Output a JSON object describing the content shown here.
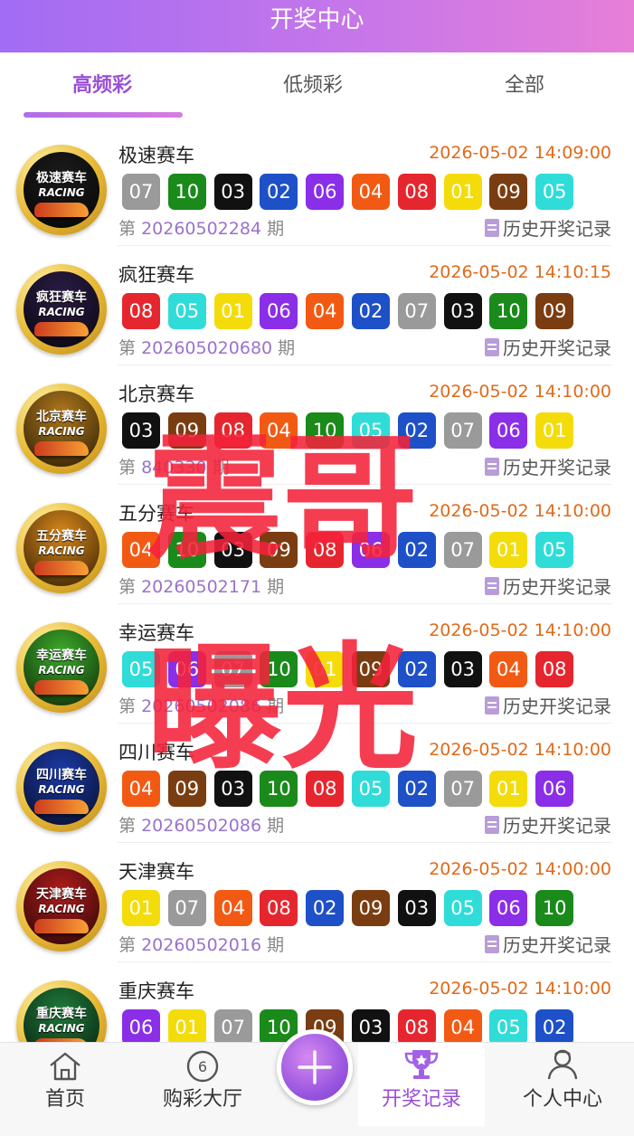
{
  "header": {
    "title": "开奖中心"
  },
  "tabs": [
    {
      "label": "高频彩",
      "active": true
    },
    {
      "label": "低频彩",
      "active": false
    },
    {
      "label": "全部",
      "active": false
    }
  ],
  "ball_colors": {
    "01": "#f4dc0a",
    "02": "#1e50c8",
    "03": "#111111",
    "04": "#f25a14",
    "05": "#2fdcd8",
    "06": "#8a2ee8",
    "07": "#9a9a9a",
    "08": "#e6262e",
    "09": "#7a3d12",
    "10": "#1a8a1a"
  },
  "lotteries": [
    {
      "badge_title": "极速赛车",
      "badge_sub": "RACING",
      "badge_color": "#1b1b1b",
      "name": "极速赛车",
      "time": "2026-05-02 14:09:00",
      "balls": [
        "07",
        "10",
        "03",
        "02",
        "06",
        "04",
        "08",
        "01",
        "09",
        "05"
      ],
      "issue_prefix": "第",
      "issue": "20260502284",
      "issue_suffix": "期",
      "history": "历史开奖记录"
    },
    {
      "badge_title": "疯狂赛车",
      "badge_sub": "RACING",
      "badge_color": "#2a1c44",
      "name": "疯狂赛车",
      "time": "2026-05-02 14:10:15",
      "balls": [
        "08",
        "05",
        "01",
        "06",
        "04",
        "02",
        "07",
        "03",
        "10",
        "09"
      ],
      "issue_prefix": "第",
      "issue": "202605020680",
      "issue_suffix": "期",
      "history": "历史开奖记录"
    },
    {
      "badge_title": "北京赛车",
      "badge_sub": "RACING",
      "badge_color": "#b0781c",
      "name": "北京赛车",
      "time": "2026-05-02 14:10:00",
      "balls": [
        "03",
        "09",
        "08",
        "04",
        "10",
        "05",
        "02",
        "07",
        "06",
        "01"
      ],
      "issue_prefix": "第",
      "issue": "840330",
      "issue_suffix": "期",
      "history": "历史开奖记录"
    },
    {
      "badge_title": "五分赛车",
      "badge_sub": "RACING",
      "badge_color": "#d8871a",
      "name": "五分赛车",
      "time": "2026-05-02 14:10:00",
      "balls": [
        "04",
        "10",
        "03",
        "09",
        "08",
        "06",
        "02",
        "07",
        "01",
        "05"
      ],
      "issue_prefix": "第",
      "issue": "20260502171",
      "issue_suffix": "期",
      "history": "历史开奖记录"
    },
    {
      "badge_title": "幸运赛车",
      "badge_sub": "RACING",
      "badge_color": "#3cac2a",
      "name": "幸运赛车",
      "time": "2026-05-02 14:10:00",
      "balls": [
        "05",
        "06",
        "07",
        "10",
        "01",
        "09",
        "02",
        "03",
        "04",
        "08"
      ],
      "issue_prefix": "第",
      "issue": "20260502086",
      "issue_suffix": "期",
      "history": "历史开奖记录"
    },
    {
      "badge_title": "四川赛车",
      "badge_sub": "RACING",
      "badge_color": "#1c3aa8",
      "name": "四川赛车",
      "time": "2026-05-02 14:10:00",
      "balls": [
        "04",
        "09",
        "03",
        "10",
        "08",
        "05",
        "02",
        "07",
        "01",
        "06"
      ],
      "issue_prefix": "第",
      "issue": "20260502086",
      "issue_suffix": "期",
      "history": "历史开奖记录"
    },
    {
      "badge_title": "天津赛车",
      "badge_sub": "RACING",
      "badge_color": "#b01c1c",
      "name": "天津赛车",
      "time": "2026-05-02 14:00:00",
      "balls": [
        "01",
        "07",
        "04",
        "08",
        "02",
        "09",
        "03",
        "05",
        "06",
        "10"
      ],
      "issue_prefix": "第",
      "issue": "20260502016",
      "issue_suffix": "期",
      "history": "历史开奖记录"
    },
    {
      "badge_title": "重庆赛车",
      "badge_sub": "RACING",
      "badge_color": "#1f7a3a",
      "name": "重庆赛车",
      "time": "2026-05-02 14:10:00",
      "balls": [
        "06",
        "01",
        "07",
        "10",
        "09",
        "03",
        "08",
        "04",
        "05",
        "02"
      ],
      "issue_prefix": "第",
      "issue": "",
      "issue_suffix": "期",
      "history": "历史开奖记录"
    }
  ],
  "watermark": {
    "line1": "震哥",
    "line2": "曝光"
  },
  "tabbar": [
    {
      "label": "首页",
      "icon": "home-icon",
      "active": false
    },
    {
      "label": "购彩大厅",
      "icon": "lottery-hall-icon",
      "active": false
    },
    {
      "label": "",
      "icon": "plus-icon",
      "active": false
    },
    {
      "label": "开奖记录",
      "icon": "trophy-icon",
      "active": true
    },
    {
      "label": "个人中心",
      "icon": "user-icon",
      "active": false
    }
  ]
}
